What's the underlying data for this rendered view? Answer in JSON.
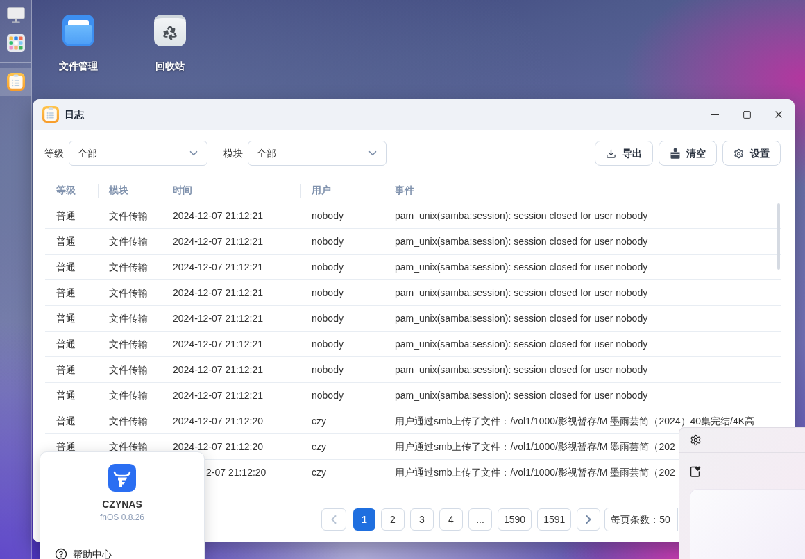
{
  "taskbar": {
    "pinned": [
      {
        "kind": "monitor",
        "selected": false
      },
      {
        "kind": "apps",
        "selected": false
      }
    ],
    "running": [
      {
        "kind": "log",
        "selected": true
      }
    ]
  },
  "desktop_icons": [
    {
      "kind": "folder",
      "label": "文件管理"
    },
    {
      "kind": "recycle",
      "label": "回收站"
    }
  ],
  "window": {
    "title": "日志"
  },
  "filters": [
    {
      "label": "等级",
      "value": "全部"
    },
    {
      "label": "模块",
      "value": "全部"
    }
  ],
  "actions": [
    {
      "kind": "export",
      "label": "导出"
    },
    {
      "kind": "clear",
      "label": "清空"
    },
    {
      "kind": "settings",
      "label": "设置"
    }
  ],
  "table": {
    "columns": [
      "等级",
      "模块",
      "时间",
      "用户",
      "事件"
    ],
    "rows": [
      {
        "level": "普通",
        "module": "文件传输",
        "time": "2024-12-07 21:12:21",
        "user": "nobody",
        "event": "pam_unix(samba:session): session closed for user nobody"
      },
      {
        "level": "普通",
        "module": "文件传输",
        "time": "2024-12-07 21:12:21",
        "user": "nobody",
        "event": "pam_unix(samba:session): session closed for user nobody"
      },
      {
        "level": "普通",
        "module": "文件传输",
        "time": "2024-12-07 21:12:21",
        "user": "nobody",
        "event": "pam_unix(samba:session): session closed for user nobody"
      },
      {
        "level": "普通",
        "module": "文件传输",
        "time": "2024-12-07 21:12:21",
        "user": "nobody",
        "event": "pam_unix(samba:session): session closed for user nobody"
      },
      {
        "level": "普通",
        "module": "文件传输",
        "time": "2024-12-07 21:12:21",
        "user": "nobody",
        "event": "pam_unix(samba:session): session closed for user nobody"
      },
      {
        "level": "普通",
        "module": "文件传输",
        "time": "2024-12-07 21:12:21",
        "user": "nobody",
        "event": "pam_unix(samba:session): session closed for user nobody"
      },
      {
        "level": "普通",
        "module": "文件传输",
        "time": "2024-12-07 21:12:21",
        "user": "nobody",
        "event": "pam_unix(samba:session): session closed for user nobody"
      },
      {
        "level": "普通",
        "module": "文件传输",
        "time": "2024-12-07 21:12:21",
        "user": "nobody",
        "event": "pam_unix(samba:session): session closed for user nobody"
      },
      {
        "level": "普通",
        "module": "文件传输",
        "time": "2024-12-07 21:12:20",
        "user": "czy",
        "event": "用户通过smb上传了文件：/vol1/1000/影视暂存/M 墨雨芸简（2024）40集完结/4K高"
      },
      {
        "level": "普通",
        "module": "文件传输",
        "time": "2024-12-07 21:12:20",
        "user": "czy",
        "event": "用户通过smb上传了文件：/vol1/1000/影视暂存/M 墨雨芸简（202"
      },
      {
        "time": "2-07 21:12:20",
        "user": "czy",
        "event": "用户通过smb上传了文件：/vol1/1000/影视暂存/M 墨雨芸简（202"
      }
    ]
  },
  "pagination": {
    "prev": {
      "disabled": true
    },
    "pages": [
      {
        "label": "1",
        "selected": true
      },
      {
        "label": "2",
        "selected": false
      },
      {
        "label": "3",
        "selected": false
      },
      {
        "label": "4",
        "selected": false
      },
      {
        "label": "...",
        "selected": false
      },
      {
        "label": "1590",
        "selected": false
      },
      {
        "label": "1591",
        "selected": false
      }
    ],
    "next": {
      "disabled": false
    },
    "page_size": "每页条数：50"
  },
  "start_menu": {
    "device_name": "CZYNAS",
    "version": "fnOS 0.8.26",
    "items": [
      {
        "label": "帮助中心"
      }
    ]
  }
}
